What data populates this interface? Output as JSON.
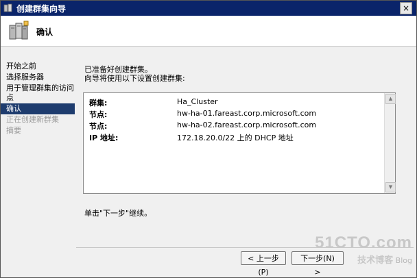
{
  "window": {
    "title": "创建群集向导",
    "close_label": "×"
  },
  "header": {
    "title": "确认",
    "icon": "cluster-servers-icon"
  },
  "sidebar": {
    "items": [
      {
        "label": "开始之前",
        "state": "normal"
      },
      {
        "label": "选择服务器",
        "state": "normal"
      },
      {
        "label": "用于管理群集的访问点",
        "state": "normal"
      },
      {
        "label": "确认",
        "state": "active"
      },
      {
        "label": "正在创建新群集",
        "state": "disabled"
      },
      {
        "label": "摘要",
        "state": "disabled"
      }
    ]
  },
  "main": {
    "intro_line1": "已准备好创建群集。",
    "intro_line2": "向导将使用以下设置创建群集:",
    "settings": [
      {
        "key": "群集:",
        "value": "Ha_Cluster"
      },
      {
        "key": "节点:",
        "value": "hw-ha-01.fareast.corp.microsoft.com"
      },
      {
        "key": "节点:",
        "value": "hw-ha-02.fareast.corp.microsoft.com"
      },
      {
        "key": "IP 地址:",
        "value": "172.18.20.0/22 上的 DHCP 地址"
      }
    ],
    "hint": "单击\"下一步\"继续。"
  },
  "buttons": {
    "prev": "< 上一步(P)",
    "next": "下一步(N) >"
  },
  "watermark": {
    "main": "51CTO.com",
    "sub": "技术博客",
    "blog": "Blog"
  }
}
